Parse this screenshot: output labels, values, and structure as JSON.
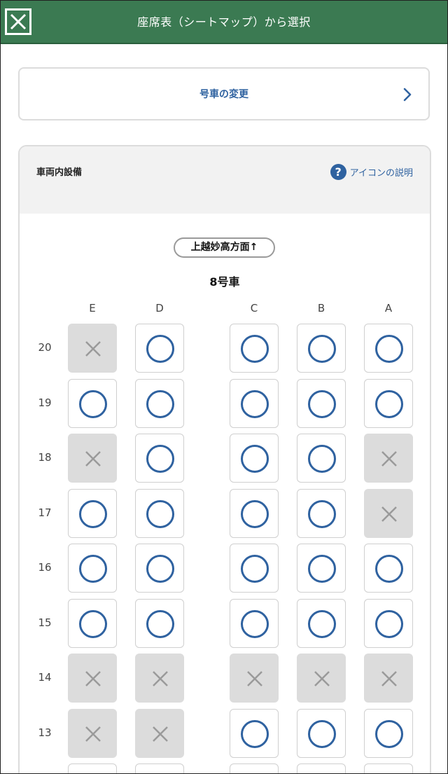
{
  "header": {
    "title": "座席表（シートマップ）から選択"
  },
  "change_car": {
    "label": "号車の変更"
  },
  "facility": {
    "title": "車両内設備",
    "help_label": "アイコンの説明"
  },
  "direction": "上越妙高方面↑",
  "car_number": "8号車",
  "columns": [
    "E",
    "D",
    "C",
    "B",
    "A"
  ],
  "rows": [
    {
      "number": "20",
      "seats": [
        "taken",
        "available",
        "available",
        "available",
        "available"
      ]
    },
    {
      "number": "19",
      "seats": [
        "available",
        "available",
        "available",
        "available",
        "available"
      ]
    },
    {
      "number": "18",
      "seats": [
        "taken",
        "available",
        "available",
        "available",
        "taken"
      ]
    },
    {
      "number": "17",
      "seats": [
        "available",
        "available",
        "available",
        "available",
        "taken"
      ]
    },
    {
      "number": "16",
      "seats": [
        "available",
        "available",
        "available",
        "available",
        "available"
      ]
    },
    {
      "number": "15",
      "seats": [
        "available",
        "available",
        "available",
        "available",
        "available"
      ]
    },
    {
      "number": "14",
      "seats": [
        "taken",
        "taken",
        "taken",
        "taken",
        "taken"
      ]
    },
    {
      "number": "13",
      "seats": [
        "taken",
        "taken",
        "available",
        "available",
        "available"
      ]
    },
    {
      "number": "",
      "seats": [
        "available",
        "available",
        "available",
        "available",
        "available"
      ]
    }
  ]
}
